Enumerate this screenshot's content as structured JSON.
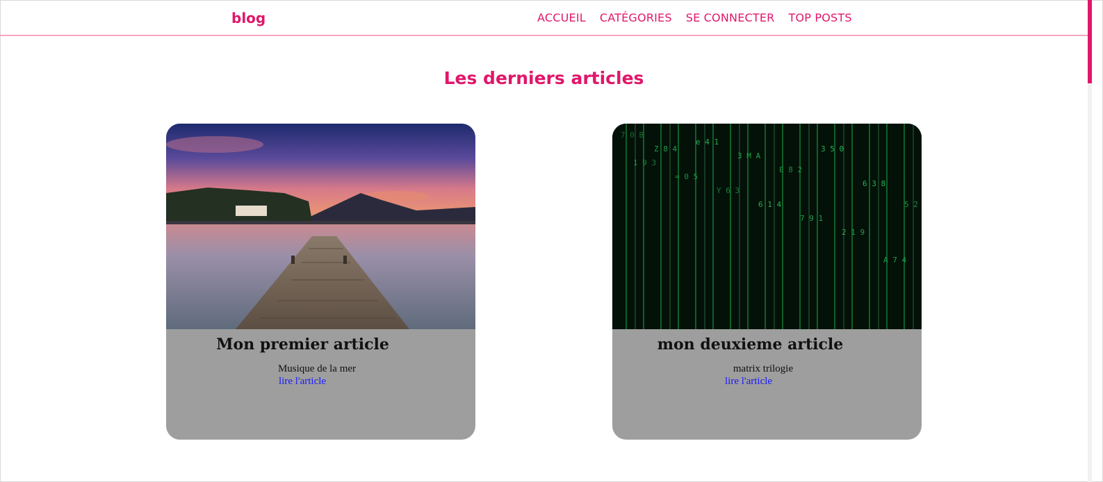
{
  "navbar": {
    "brand": "blog",
    "links": [
      "ACCUEIL",
      "CATÉGORIES",
      "SE CONNECTER",
      "TOP POSTS"
    ]
  },
  "page": {
    "title": "Les derniers articles"
  },
  "articles": [
    {
      "title": "Mon premier article",
      "description": "Musique de la mer",
      "link": "lire l'article",
      "image_icon": "lake-sunset-pier-image"
    },
    {
      "title": "mon deuxieme article",
      "description": "matrix trilogie",
      "link": "lire l'article",
      "image_icon": "matrix-code-rain-image"
    }
  ],
  "colors": {
    "accent": "#e0176a",
    "nav_border": "#f4a7c4",
    "card_bg": "#9e9e9e",
    "link": "#1a1aff"
  }
}
